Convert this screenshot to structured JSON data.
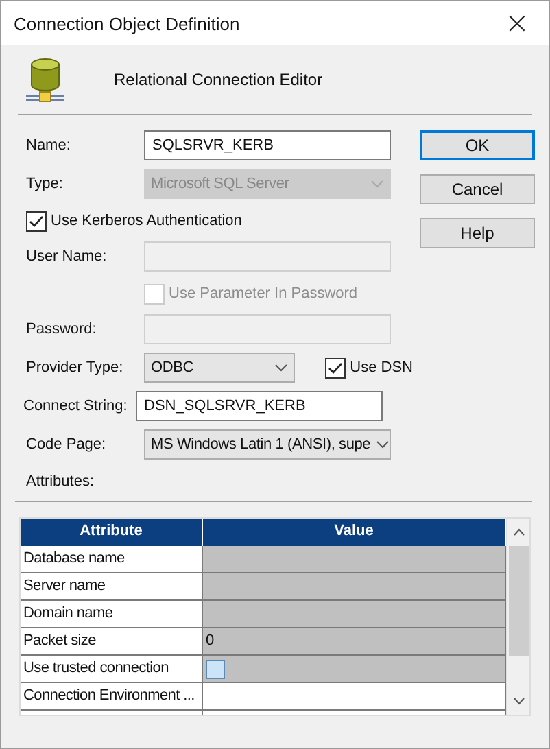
{
  "window": {
    "title": "Connection Object Definition",
    "close": "×"
  },
  "header": {
    "subtitle": "Relational Connection Editor"
  },
  "fields": [
    {
      "kind": "text",
      "label": "Name:",
      "value": "SQLSRVR_KERB",
      "disabled": false
    },
    {
      "kind": "combo",
      "label": "Type:",
      "value": "Microsoft SQL Server",
      "disabled": true
    },
    {
      "kind": "check",
      "label": "Use Kerberos Authentication",
      "checked": true,
      "disabled": false
    },
    {
      "kind": "text",
      "label": "User Name:",
      "disabled": true
    },
    {
      "kind": "subcheck",
      "label": "Use Parameter In Password",
      "checked": false,
      "disabled": true
    },
    {
      "kind": "text",
      "label": "Password:",
      "disabled": true
    },
    {
      "kind": "combo",
      "label": "Provider Type:",
      "value": "ODBC",
      "disabled": false,
      "extra": {
        "label": "Use DSN",
        "checked": true
      }
    },
    {
      "kind": "text",
      "label": "Connect String:",
      "value": "DSN_SQLSRVR_KERB",
      "disabled": false
    },
    {
      "kind": "combo",
      "label": "Code Page:",
      "value": "MS Windows Latin 1 (ANSI), supe",
      "disabled": false
    }
  ],
  "buttons": [
    {
      "label": "OK",
      "default": true
    },
    {
      "label": "Cancel",
      "default": false
    },
    {
      "label": "Help",
      "default": false
    }
  ],
  "attributes_label": "Attributes:",
  "table": {
    "columns": [
      "Attribute",
      "Value"
    ],
    "rows": [
      {
        "attribute": "Database name",
        "kind": "text",
        "disabled": true
      },
      {
        "attribute": "Server name",
        "kind": "text",
        "disabled": true
      },
      {
        "attribute": "Domain name",
        "kind": "text",
        "disabled": true
      },
      {
        "attribute": "Packet size",
        "kind": "text",
        "value": "0",
        "disabled": true
      },
      {
        "attribute": "Use trusted connection",
        "kind": "checkbox",
        "checked": false,
        "disabled": true
      },
      {
        "attribute": "Connection Environment ...",
        "kind": "text",
        "disabled": false
      }
    ]
  }
}
